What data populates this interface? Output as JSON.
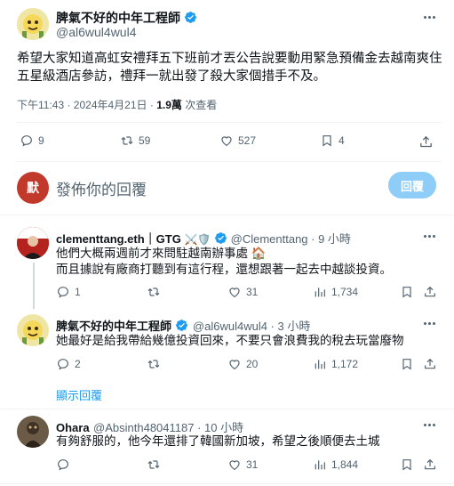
{
  "main_tweet": {
    "display_name": "脾氣不好的中年工程師",
    "handle": "@al6wul4wul4",
    "text_line1": "希望大家知道高虹安禮拜五下班前才丟公告說要動用緊急預備金去越南爽住",
    "text_line2": "五星級酒店參訪，禮拜一就出發了殺大家個措手不及。",
    "time": "下午11:43 · 2024年4月21日 · ",
    "views_count": "1.9萬",
    "views_label": " 次查看",
    "stats": {
      "replies": "9",
      "retweets": "59",
      "likes": "527",
      "bookmarks": "4"
    }
  },
  "reply_box": {
    "avatar_letter": "默",
    "placeholder": "發佈你的回覆",
    "button_label": "回覆",
    "avatar_color": "#c0392b"
  },
  "replies": [
    {
      "display_name": "clementtang.eth｜GTG",
      "name_emoji": "⚔️🛡️",
      "handle_time": "@Clementtang · 9 小時",
      "line1": "他們大概兩週前才來問駐越南辦事處 🏠",
      "line2": "而且據說有廠商打聽到有這行程，還想跟著一起去中越談投資。",
      "stats": {
        "replies": "1",
        "retweets": "",
        "likes": "31",
        "views": "1,734"
      }
    },
    {
      "display_name": "脾氣不好的中年工程師",
      "handle_time": "@al6wul4wul4 · 3 小時",
      "line1": "她最好是給我帶給幾億投資回來，不要只會浪費我的稅去玩當廢物",
      "stats": {
        "replies": "2",
        "retweets": "",
        "likes": "20",
        "views": "1,172"
      },
      "show_replies": "顯示回覆"
    },
    {
      "display_name": "Ohara",
      "handle_time": "@Absinth48041187 · 10 小時",
      "line1": "有夠舒服的，他今年還排了韓國新加坡，希望之後順便去土城",
      "stats": {
        "replies": "",
        "retweets": "",
        "likes": "31",
        "views": "1,844"
      }
    }
  ],
  "colors": {
    "accent": "#1d9bf0",
    "muted": "#536471",
    "reply_button": "#8ecdf7"
  }
}
